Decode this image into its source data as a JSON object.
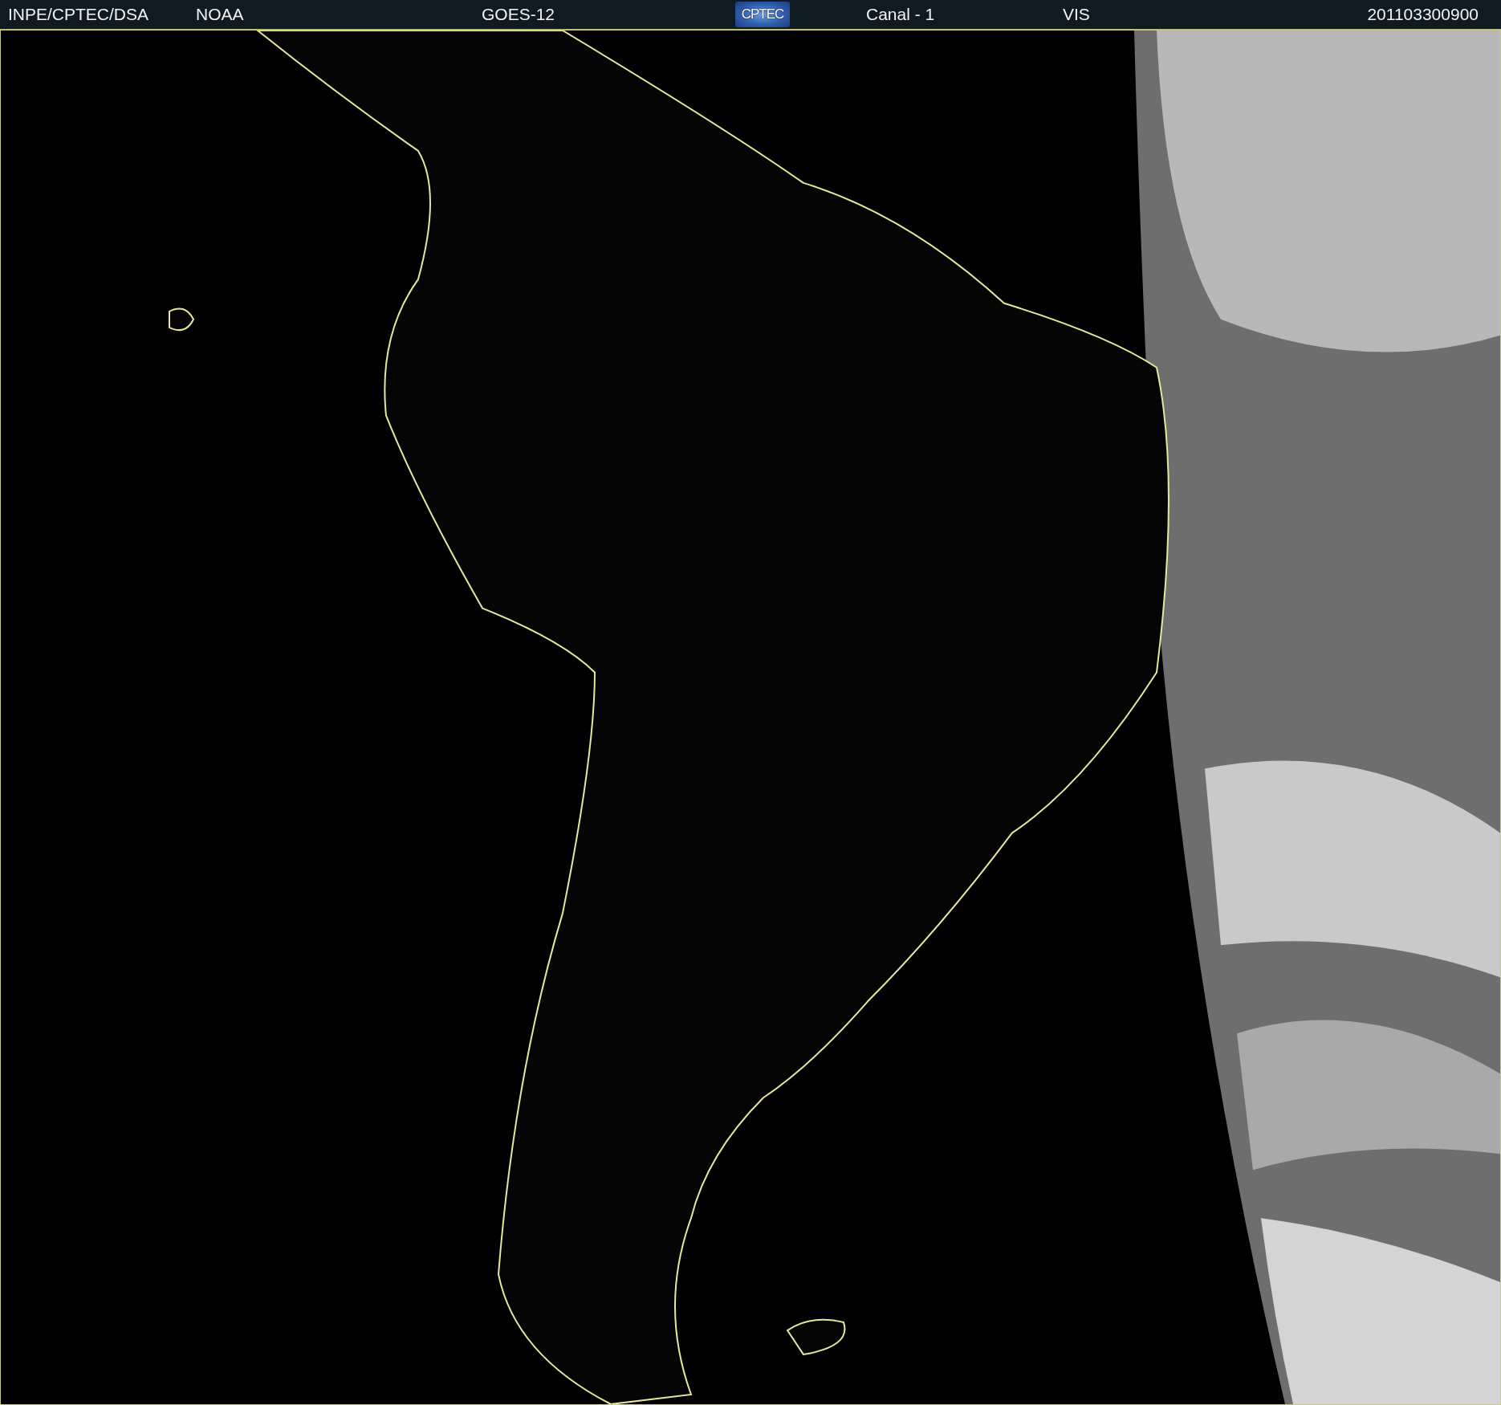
{
  "header": {
    "items": [
      {
        "kind": "text",
        "text": "INPE/CPTEC/DSA"
      },
      {
        "kind": "text",
        "text": "NOAA"
      },
      {
        "kind": "text",
        "text": "GOES-12"
      },
      {
        "kind": "logo",
        "text": "CPTEC"
      },
      {
        "kind": "text",
        "text": "Canal - 1"
      },
      {
        "kind": "text",
        "text": "VIS"
      },
      {
        "kind": "text",
        "text": "201103300900"
      }
    ]
  }
}
